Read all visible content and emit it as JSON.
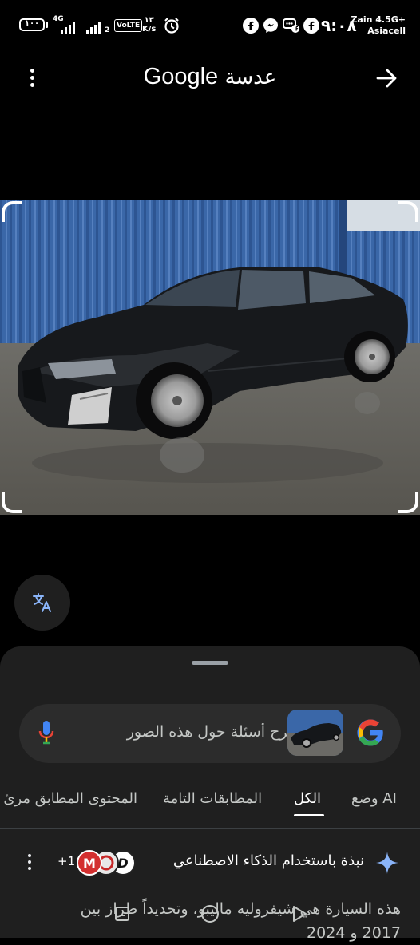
{
  "status_bar": {
    "battery": "١٠٠",
    "network_badge": "4G",
    "sim2_index": "2",
    "volte": "VoLTE",
    "speed_value": "١٣",
    "speed_unit": "K/s",
    "time": "٩:٠٨",
    "carrier_line1": "Zain 4.5G+",
    "carrier_line2": "Asiacell",
    "icons": [
      "signal-icon",
      "alarm-icon",
      "facebook-icon",
      "messenger-icon",
      "chat-icon",
      "facebook-icon"
    ]
  },
  "header": {
    "brand": "Google",
    "title": "عدسة",
    "menu_icon": "more-vert-icon",
    "back_icon": "arrow-forward-icon"
  },
  "image": {
    "subject": "black sedan photo"
  },
  "translate": {
    "icon": "translate-icon"
  },
  "search": {
    "placeholder": "طرح أسئلة حول هذه الصور",
    "mic_icon": "mic-icon",
    "google_icon": "google-g-icon"
  },
  "tabs": [
    {
      "label": "وضع AI",
      "active": false
    },
    {
      "label": "الكل",
      "active": true
    },
    {
      "label": "المطابقات التامة",
      "active": false
    },
    {
      "label": "المحتوى المطابق مرئ",
      "active": false
    }
  ],
  "ai_overview": {
    "label": "نبذة باستخدام الذكاء الاصطناعي",
    "sources_count": "+1",
    "icon": "sparkle-icon"
  },
  "summary": {
    "line1": "هذه السيارة هي شيفروليه ماليبو، وتحديداً طراز بين",
    "line2": "2017 و 2024"
  },
  "colors": {
    "background": "#000000",
    "sheet": "#1f1f1f",
    "search": "#2c2c2c",
    "accent_blue": "#8ab4f8"
  }
}
